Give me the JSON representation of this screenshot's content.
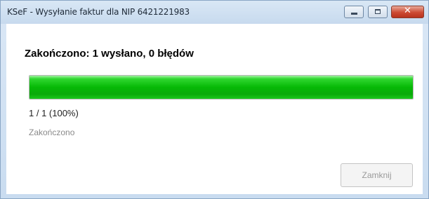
{
  "window": {
    "title": "KSeF - Wysyłanie faktur dla NIP 6421221983",
    "controls": {
      "minimize_icon": "minimize-icon",
      "maximize_icon": "maximize-icon",
      "close_icon": "close-icon",
      "close_glyph": "✕"
    }
  },
  "dialog": {
    "heading": "Zakończono: 1 wysłano, 0 błędów",
    "progress_fraction": 1.0,
    "progress_text": "1 / 1  (100%)",
    "status": "Zakończono",
    "close_button_label": "Zamknij",
    "close_button_enabled": false
  },
  "colors": {
    "progress_fill": "#06b906",
    "status_text": "#8a8a8a"
  }
}
